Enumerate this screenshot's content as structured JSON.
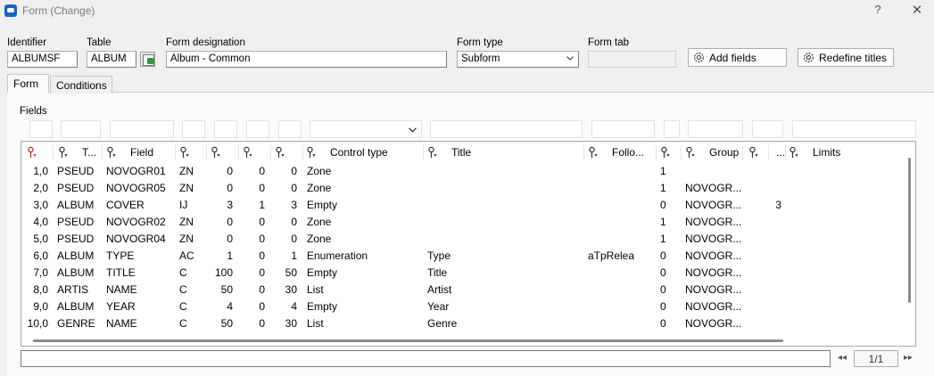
{
  "window": {
    "title": "Form (Change)",
    "help": "?",
    "close": "✕"
  },
  "header": {
    "identifier_label": "Identifier",
    "identifier_value": "ALBUMSF",
    "table_label": "Table",
    "table_value": "ALBUM",
    "designation_label": "Form designation",
    "designation_value": "Album - Common",
    "formtype_label": "Form type",
    "formtype_value": "Subform",
    "formtab_label": "Form tab",
    "formtab_value": "",
    "add_fields_label": "Add fields",
    "redefine_titles_label": "Redefine titles"
  },
  "tabs": [
    {
      "label": "Form",
      "active": true
    },
    {
      "label": "Conditions",
      "active": false
    }
  ],
  "fields_label": "Fields",
  "grid": {
    "columns": [
      "",
      "T...",
      "Field",
      "",
      "",
      "",
      "",
      "Control type",
      "Title",
      "Follo...",
      "",
      "Group",
      "",
      "...",
      "Limits"
    ],
    "rows": [
      [
        "1,0",
        "PSEUD",
        "NOVOGR01",
        "ZN",
        "0",
        "0",
        "0",
        "Zone",
        "",
        "",
        "1",
        "",
        ""
      ],
      [
        "2,0",
        "PSEUD",
        "NOVOGR05",
        "ZN",
        "0",
        "0",
        "0",
        "Zone",
        "",
        "",
        "1",
        "NOVOGR...",
        ""
      ],
      [
        "3,0",
        "ALBUM",
        "COVER",
        "IJ",
        "3",
        "1",
        "3",
        "Empty",
        "",
        "",
        "0",
        "NOVOGR...",
        "3"
      ],
      [
        "4,0",
        "PSEUD",
        "NOVOGR02",
        "ZN",
        "0",
        "0",
        "0",
        "Zone",
        "",
        "",
        "1",
        "NOVOGR...",
        ""
      ],
      [
        "5,0",
        "PSEUD",
        "NOVOGR04",
        "ZN",
        "0",
        "0",
        "0",
        "Zone",
        "",
        "",
        "1",
        "NOVOGR...",
        ""
      ],
      [
        "6,0",
        "ALBUM",
        "TYPE",
        "AC",
        "1",
        "0",
        "1",
        "Enumeration",
        "Type",
        "aTpRelea",
        "0",
        "NOVOGR...",
        ""
      ],
      [
        "7,0",
        "ALBUM",
        "TITLE",
        "C",
        "100",
        "0",
        "50",
        "Empty",
        "Title",
        "",
        "0",
        "NOVOGR...",
        ""
      ],
      [
        "8,0",
        "ARTIS",
        "NAME",
        "C",
        "50",
        "0",
        "30",
        "List",
        "Artist",
        "",
        "0",
        "NOVOGR...",
        ""
      ],
      [
        "9,0",
        "ALBUM",
        "YEAR",
        "C",
        "4",
        "0",
        "4",
        "Empty",
        "Year",
        "",
        "0",
        "NOVOGR...",
        ""
      ],
      [
        "10,0",
        "GENRE",
        "NAME",
        "C",
        "50",
        "0",
        "30",
        "List",
        "Genre",
        "",
        "0",
        "NOVOGR...",
        ""
      ]
    ]
  },
  "footer": {
    "page": "1/1",
    "prev": "◂◂",
    "next": "▸▸"
  },
  "icons": {
    "app": "app-icon",
    "gear": "gear-icon",
    "sort": "sort-icon",
    "table_select": "table-select-icon",
    "dropdown": "chevron-down-icon"
  },
  "colors": {
    "sort_first": "#cc2222",
    "sort": "#333333",
    "app_icon": "#1565c0"
  }
}
